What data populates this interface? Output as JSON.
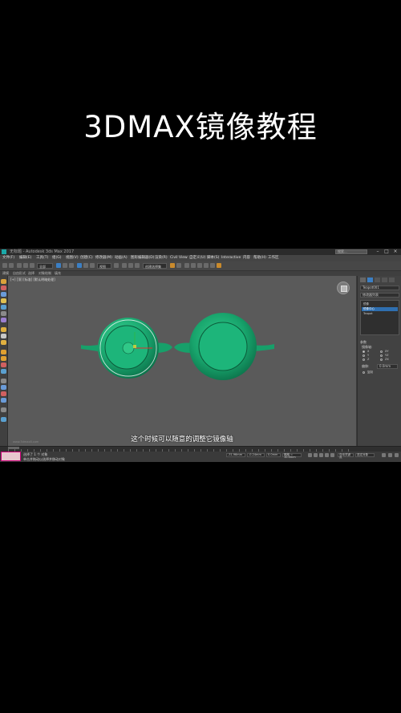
{
  "page_title": "3DMAX镜像教程",
  "app": {
    "window_title": "无标题 - Autodesk 3ds Max 2017",
    "search_placeholder": "搜索...",
    "menu": [
      "文件(F)",
      "编辑(E)",
      "工具(T)",
      "组(G)",
      "视图(V)",
      "创建(C)",
      "修改器(M)",
      "动画(A)",
      "图形编辑器(D)",
      "渲染(R)",
      "Civil View",
      "自定义(U)",
      "脚本(S)",
      "Interactive",
      "内容",
      "帮助(H)",
      "工作区"
    ],
    "toolbar": {
      "selection_dropdown": "全部",
      "view_dropdown": "视图",
      "selection_set": "创建选择集"
    },
    "ribbon": [
      "建模",
      "自由形式",
      "选择",
      "对象绘制",
      "填充"
    ],
    "ribbon_sub": "多边形建模",
    "viewport": {
      "label": "[+] [顶] [标准] [默认明暗处理]",
      "subtitle": "这个时候可以随意的调整它镜像轴",
      "watermark": "www.3dmax8.com"
    },
    "command_panel": {
      "object_name": "Teapot001",
      "modifier_list": "修改器列表",
      "stack_items": [
        "镜像",
        "镜像中心",
        "Teapot"
      ],
      "section_mirror": "参数",
      "mirror_axis_label": "镜像轴:",
      "axes": [
        "X",
        "Y",
        "Z",
        "XY",
        "YZ",
        "ZX"
      ],
      "offset_label": "偏移:",
      "offset_value": "0.0mm",
      "copy_label": "复制"
    },
    "status": {
      "selection_info": "选择了 1 个 对象",
      "hint": "单击并拖动以选择并移动对象",
      "x_label": "X:",
      "x_value": "-31.96mm",
      "y_label": "Y:",
      "y_value": "-0.24mm",
      "z_label": "Z:",
      "z_value": "0.0mm",
      "grid": "栅格 = 10.0mm",
      "auto_key": "自动关键点",
      "set_key": "设置关键点",
      "selected": "选定对象",
      "frame": "0 / 100"
    },
    "colors": {
      "teapot_fill": "#1aa870",
      "teapot_dark": "#0b6f48",
      "viewport_bg": "#5a5a5a",
      "selection_blue": "#2f6fb0"
    }
  }
}
